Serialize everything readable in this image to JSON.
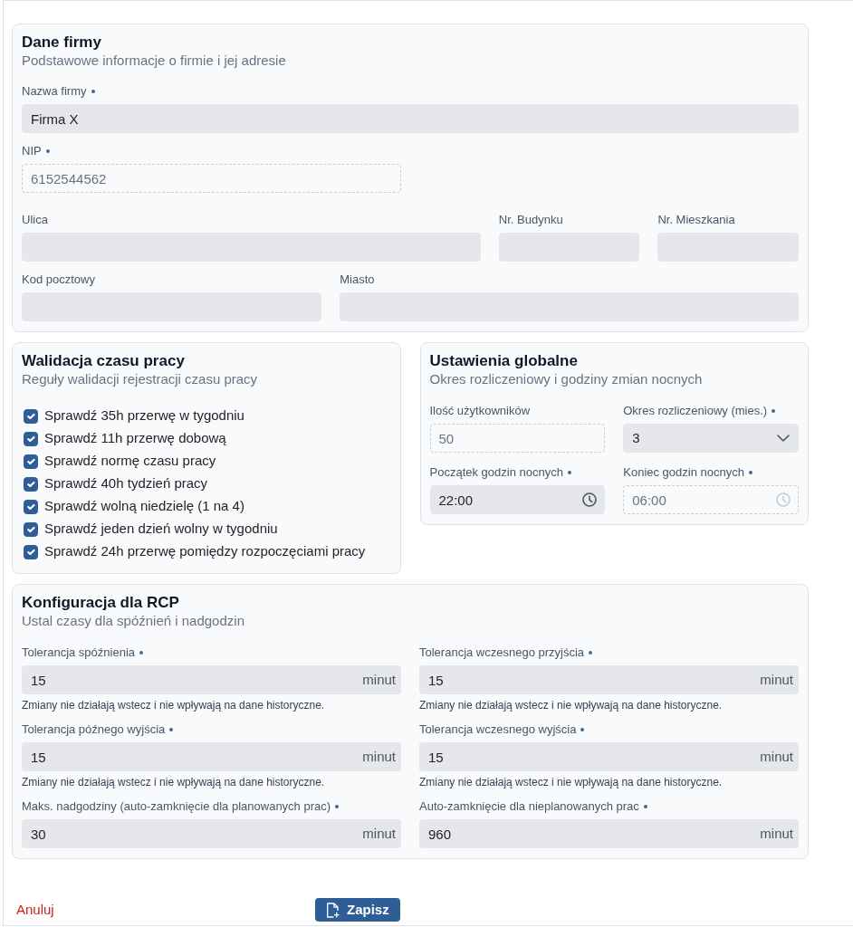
{
  "company": {
    "title": "Dane firmy",
    "subtitle": "Podstawowe informacje o firmie i jej adresie",
    "fields": [
      {
        "label": "Nazwa firmy",
        "required": true,
        "value": "Firma X",
        "disabled": false
      },
      {
        "label": "NIP",
        "required": true,
        "value": "6152544562",
        "disabled": true
      },
      {
        "label": "Ulica",
        "required": false,
        "disabled": false
      },
      {
        "label": "Nr. Budynku",
        "required": false,
        "disabled": false
      },
      {
        "label": "Nr. Mieszkania",
        "required": false,
        "disabled": false
      },
      {
        "label": "Kod pocztowy",
        "required": false,
        "disabled": false
      },
      {
        "label": "Miasto",
        "required": false,
        "disabled": false
      }
    ]
  },
  "validation": {
    "title": "Walidacja czasu pracy",
    "subtitle": "Reguły walidacji rejestracji czasu pracy",
    "rules": [
      {
        "label": "Sprawdź 35h przerwę w tygodniu",
        "checked": true
      },
      {
        "label": "Sprawdź 11h przerwę dobową",
        "checked": true
      },
      {
        "label": "Sprawdź normę czasu pracy",
        "checked": true
      },
      {
        "label": "Sprawdź 40h tydzień pracy",
        "checked": true
      },
      {
        "label": "Sprawdź wolną niedzielę (1 na 4)",
        "checked": true
      },
      {
        "label": "Sprawdź jeden dzień wolny w tygodniu",
        "checked": true
      },
      {
        "label": "Sprawdź 24h przerwę pomiędzy rozpoczęciami pracy",
        "checked": true
      }
    ]
  },
  "global": {
    "title": "Ustawienia globalne",
    "subtitle": "Okres rozliczeniowy i godziny zmian nocnych",
    "fields": [
      {
        "kind": "number",
        "label": "Ilość użytkowników",
        "required": false,
        "value": "50",
        "disabled": true
      },
      {
        "kind": "select",
        "label": "Okres rozliczeniowy (mies.)",
        "required": true,
        "value": "3",
        "disabled": false
      },
      {
        "kind": "time",
        "label": "Początek godzin nocnych",
        "required": true,
        "value": "22:00",
        "disabled": false
      },
      {
        "kind": "time",
        "label": "Koniec godzin nocnych",
        "required": true,
        "value": "06:00",
        "disabled": true
      }
    ]
  },
  "rcp": {
    "title": "Konfiguracja dla RCP",
    "subtitle": "Ustal czasy dla spóźnień i nadgodzin",
    "fields": [
      {
        "label": "Tolerancja spóźnienia",
        "required": true,
        "value": "15",
        "unit": "minut",
        "help": "Zmiany nie działają wstecz i nie wpływają na dane historyczne."
      },
      {
        "label": "Tolerancja wczesnego przyjścia",
        "required": true,
        "value": "15",
        "unit": "minut",
        "help": "Zmiany nie działają wstecz i nie wpływają na dane historyczne."
      },
      {
        "label": "Tolerancja późnego wyjścia",
        "required": true,
        "value": "15",
        "unit": "minut",
        "help": "Zmiany nie działają wstecz i nie wpływają na dane historyczne."
      },
      {
        "label": "Tolerancja wczesnego wyjścia",
        "required": true,
        "value": "15",
        "unit": "minut",
        "help": "Zmiany nie działają wstecz i nie wpływają na dane historyczne."
      },
      {
        "label": "Maks. nadgodziny (auto-zamknięcie dla planowanych prac)",
        "required": true,
        "value": "30",
        "unit": "minut"
      },
      {
        "label": "Auto-zamknięcie dla nieplanowanych prac",
        "required": true,
        "value": "960",
        "unit": "minut"
      }
    ]
  },
  "actions": {
    "cancel": "Anuluj",
    "save": "Zapisz"
  }
}
